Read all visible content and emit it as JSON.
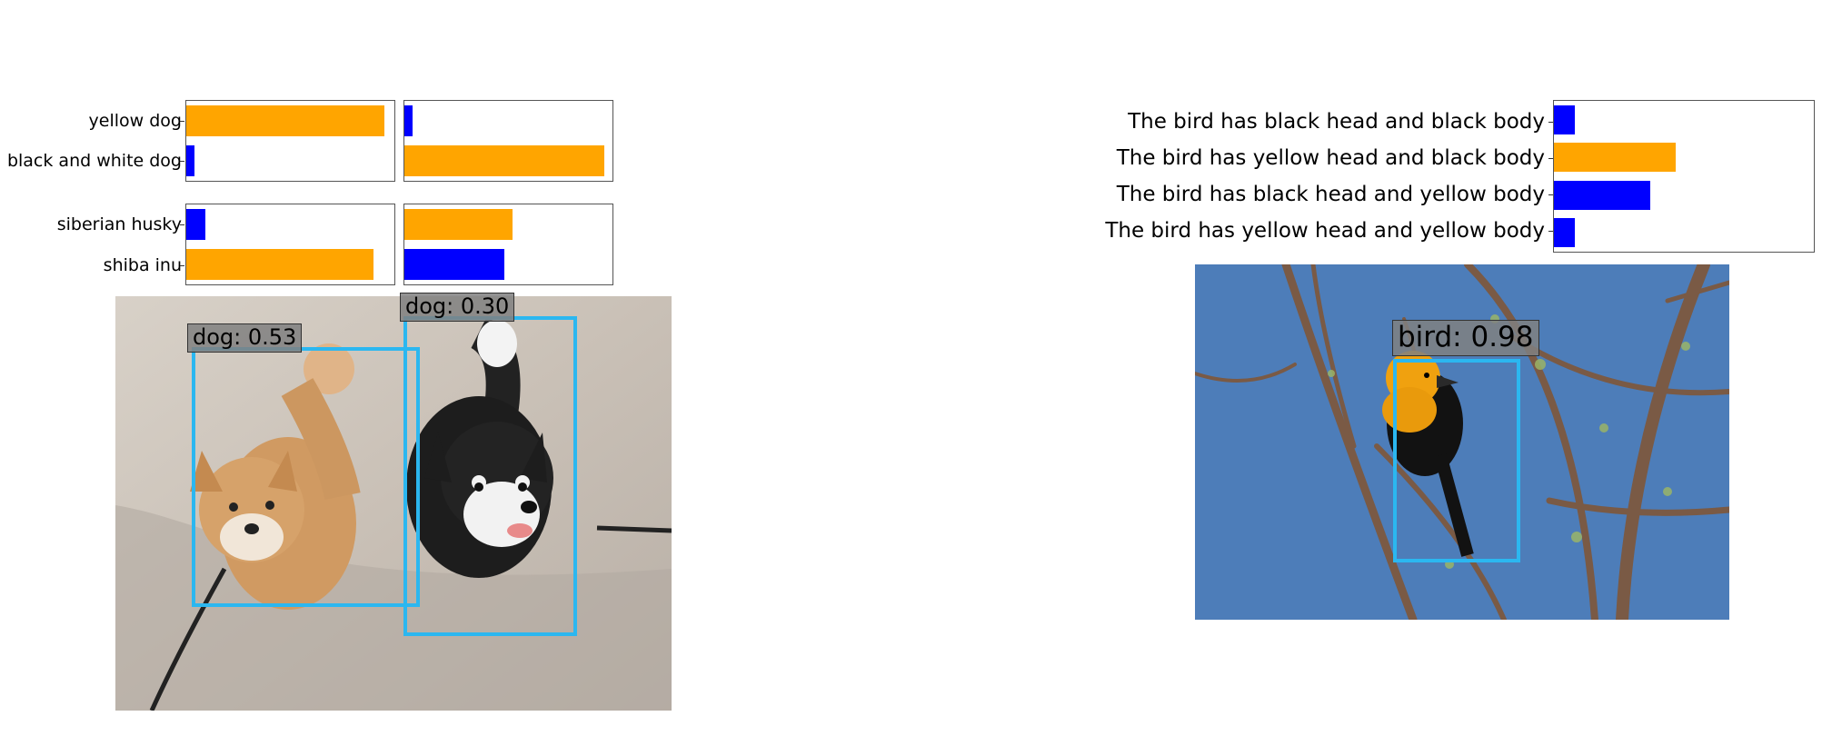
{
  "colors": {
    "orange": "#FFA500",
    "blue": "#0000FF",
    "box": "#2bb7f0"
  },
  "left_figure": {
    "detections": [
      {
        "label": "dog: 0.53",
        "icon": "dog-photo"
      },
      {
        "label": "dog: 0.30",
        "icon": "dog-photo"
      }
    ]
  },
  "right_figure": {
    "detections": [
      {
        "label": "bird: 0.98",
        "icon": "bird-photo"
      }
    ]
  },
  "chart_data": [
    {
      "type": "bar",
      "orientation": "horizontal",
      "categories": [
        "yellow dog",
        "black and white dog"
      ],
      "values": [
        0.95,
        0.04
      ],
      "colors": [
        "#FFA500",
        "#0000FF"
      ],
      "xlim": [
        0,
        1
      ]
    },
    {
      "type": "bar",
      "orientation": "horizontal",
      "categories": [
        "yellow dog",
        "black and white dog"
      ],
      "values": [
        0.04,
        0.96
      ],
      "colors": [
        "#0000FF",
        "#FFA500"
      ],
      "xlim": [
        0,
        1
      ]
    },
    {
      "type": "bar",
      "orientation": "horizontal",
      "categories": [
        "siberian husky",
        "shiba inu"
      ],
      "values": [
        0.09,
        0.9
      ],
      "colors": [
        "#0000FF",
        "#FFA500"
      ],
      "xlim": [
        0,
        1
      ]
    },
    {
      "type": "bar",
      "orientation": "horizontal",
      "categories": [
        "siberian husky",
        "shiba inu"
      ],
      "values": [
        0.52,
        0.48
      ],
      "colors": [
        "#FFA500",
        "#0000FF"
      ],
      "xlim": [
        0,
        1
      ]
    },
    {
      "type": "bar",
      "orientation": "horizontal",
      "categories": [
        "The bird has black head and black body",
        "The bird has yellow head and black body",
        "The bird has black head and yellow body",
        "The bird has yellow head and yellow body"
      ],
      "values": [
        0.08,
        0.47,
        0.37,
        0.08
      ],
      "colors": [
        "#0000FF",
        "#FFA500",
        "#0000FF",
        "#0000FF"
      ],
      "xlim": [
        0,
        1
      ]
    }
  ]
}
